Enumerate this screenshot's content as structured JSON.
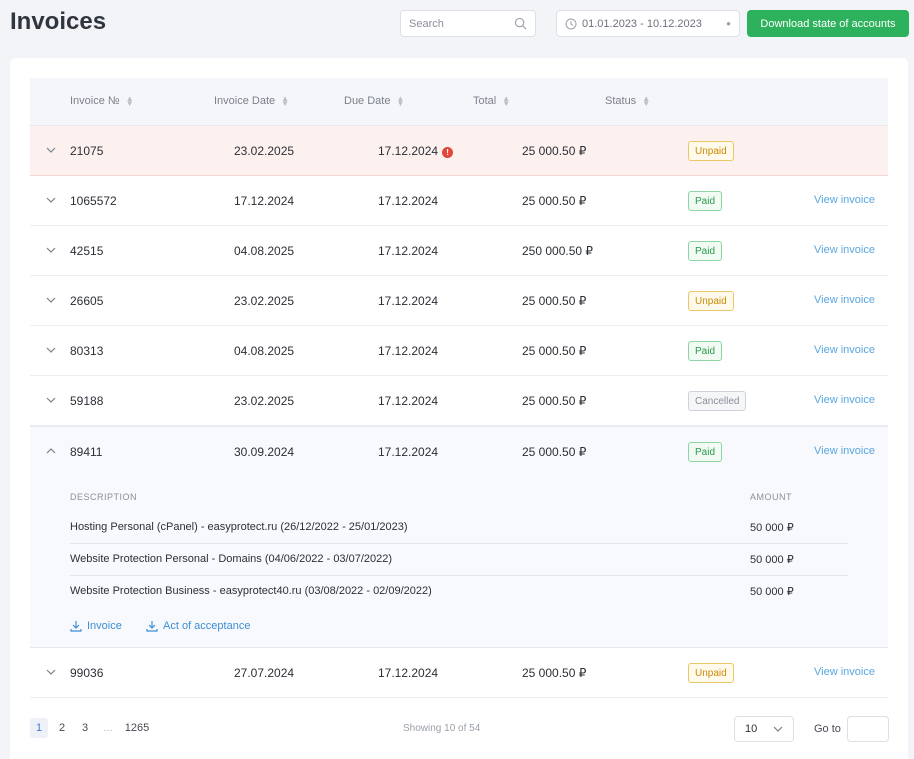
{
  "page": {
    "title": "Invoices"
  },
  "toolbar": {
    "search_placeholder": "Search",
    "date_range": "01.01.2023 - 10.12.2023",
    "download_label": "Download state of accounts"
  },
  "table": {
    "headers": [
      "Invoice №",
      "Invoice Date",
      "Due Date",
      "Total",
      "Status"
    ],
    "view_invoice_label": "View invoice",
    "rows": [
      {
        "id": "21075",
        "invoice_date": "23.02.2025",
        "due_date": "17.12.2024",
        "total": "25 000.50 ₽",
        "status": "Unpaid",
        "overdue": true
      },
      {
        "id": "1065572",
        "invoice_date": "17.12.2024",
        "due_date": "17.12.2024",
        "total": "25 000.50 ₽",
        "status": "Paid"
      },
      {
        "id": "42515",
        "invoice_date": "04.08.2025",
        "due_date": "17.12.2024",
        "total": "250 000.50 ₽",
        "status": "Paid"
      },
      {
        "id": "26605",
        "invoice_date": "23.02.2025",
        "due_date": "17.12.2024",
        "total": "25 000.50 ₽",
        "status": "Unpaid"
      },
      {
        "id": "80313",
        "invoice_date": "04.08.2025",
        "due_date": "17.12.2024",
        "total": "25 000.50 ₽",
        "status": "Paid"
      },
      {
        "id": "59188",
        "invoice_date": "23.02.2025",
        "due_date": "17.12.2024",
        "total": "25 000.50 ₽",
        "status": "Cancelled"
      },
      {
        "id": "89411",
        "invoice_date": "30.09.2024",
        "due_date": "17.12.2024",
        "total": "25 000.50 ₽",
        "status": "Paid",
        "expanded": true
      },
      {
        "id": "99036",
        "invoice_date": "27.07.2024",
        "due_date": "17.12.2024",
        "total": "25 000.50 ₽",
        "status": "Unpaid"
      }
    ]
  },
  "details": {
    "description_header": "DESCRIPTION",
    "amount_header": "AMOUNT",
    "lines": [
      {
        "description": "Hosting Personal (cPanel) - easyprotect.ru (26/12/2022 - 25/01/2023)",
        "amount": "50 000 ₽"
      },
      {
        "description": "Website Protection Personal - Domains (04/06/2022 - 03/07/2022)",
        "amount": "50 000 ₽"
      },
      {
        "description": "Website Protection Business - easyprotect40.ru (03/08/2022 - 02/09/2022)",
        "amount": "50 000 ₽"
      }
    ],
    "invoice_link": "Invoice",
    "act_link": "Act of acceptance"
  },
  "pagination": {
    "pages": [
      "1",
      "2",
      "3",
      "...",
      "1265"
    ],
    "current": "1",
    "showing": "Showing 10 of 54",
    "per_page": "10",
    "goto_label": "Go to"
  },
  "colors": {
    "primary_green": "#2db15c",
    "link_blue": "#5aa6e0",
    "overdue_bg": "#fdf1ef",
    "warning_red": "#e0463a"
  }
}
